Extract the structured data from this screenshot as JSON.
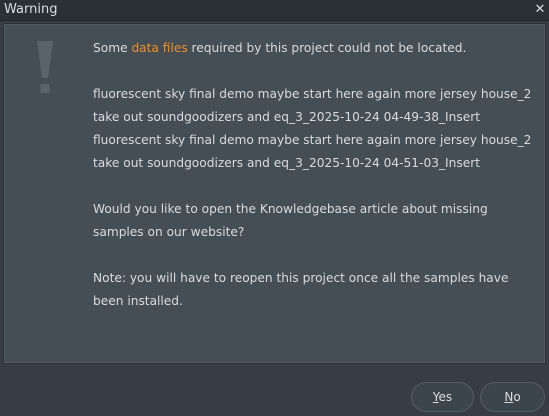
{
  "window": {
    "title": "Warning",
    "close_glyph": "✕"
  },
  "icon": {
    "name": "exclamation-icon",
    "color": "#5b636a"
  },
  "message": {
    "intro_before": "Some ",
    "intro_link": "data files",
    "intro_after": " required by this project could not be located.",
    "files_line_1": "fluorescent sky final demo maybe start here again more jersey house_2 take out soundgoodizers and eq_3_2025-10-24 04-49-38_Insert",
    "files_line_2": "fluorescent sky final demo maybe start here again more jersey house_2 take out soundgoodizers and eq_3_2025-10-24 04-51-03_Insert",
    "question": "Would you like to open the Knowledgebase article about missing samples on our website?",
    "note": "Note: you will have to reopen this project once all the samples have been installed."
  },
  "buttons": {
    "yes_accel": "Y",
    "yes_rest": "es",
    "no_accel": "N",
    "no_rest": "o"
  },
  "colors": {
    "link": "#e8902b",
    "text": "#d7dbde",
    "panel": "#464e55",
    "background": "#363d44"
  }
}
